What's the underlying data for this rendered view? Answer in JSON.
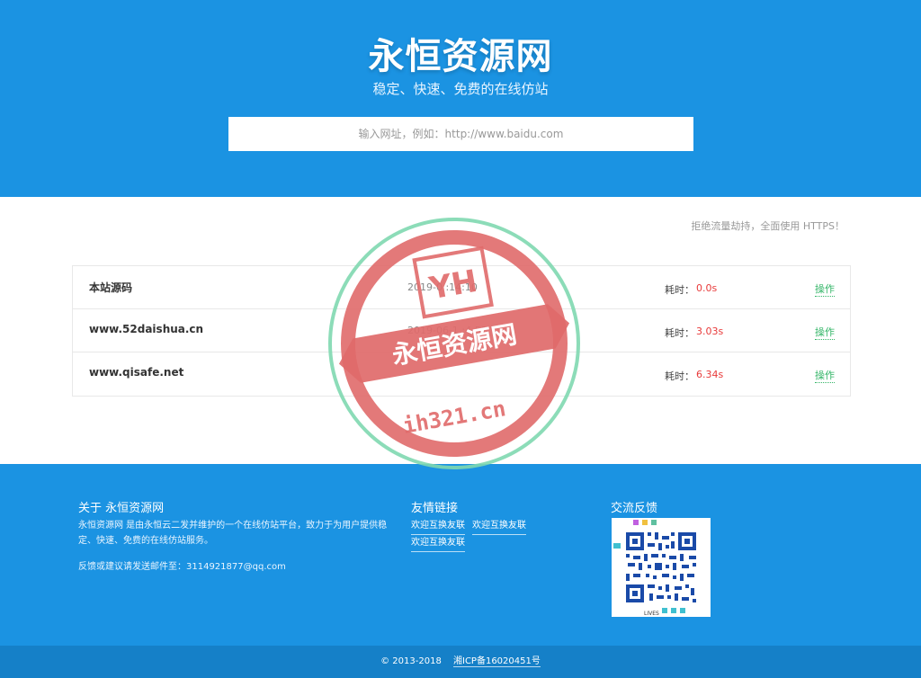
{
  "hero": {
    "title": "永恒资源网",
    "subtitle": "稳定、快速、免费的在线仿站",
    "search_placeholder": "输入网址，例如：http://www.baidu.com"
  },
  "notice": "拒绝流量劫持，全面使用 HTTPS！",
  "sites": [
    {
      "name": "本站源码",
      "time": "2019-0 :14:10",
      "cost_label": "耗时：",
      "cost": "0.0s",
      "action": "操作"
    },
    {
      "name": "www.52daishua.cn",
      "time": "2019-06-1 :4:51",
      "cost_label": "耗时：",
      "cost": "3.03s",
      "action": "操作"
    },
    {
      "name": "www.qisafe.net",
      "time": "",
      "cost_label": "耗时：",
      "cost": "6.34s",
      "action": "操作"
    }
  ],
  "footer": {
    "about_title": "关于 永恒资源网",
    "about_text": "永恒资源网 是由永恒云二发并维护的一个在线仿站平台，致力于为用户提供稳定、快速、免费的在线仿站服务。",
    "mail_text": "反馈或建议请发送邮件至：3114921877@qq.com",
    "links_title": "友情链接",
    "links": [
      "欢迎互换友联",
      "欢迎互换友联",
      "欢迎互换友联"
    ],
    "feedback_title": "交流反馈",
    "qr_caption": "LIVES"
  },
  "bottom": {
    "copyright": "© 2013-2018",
    "icp": "湘ICP备16020451号"
  },
  "watermark": {
    "logo": "YH",
    "banner": "永恒资源网",
    "domain": "ih321.cn"
  },
  "colors": {
    "brand_blue": "#1b93e2",
    "cost_red": "#e83a3a",
    "action_green": "#33b567",
    "stamp_red": "#e06a6a",
    "stamp_green": "#7fd8b0"
  }
}
